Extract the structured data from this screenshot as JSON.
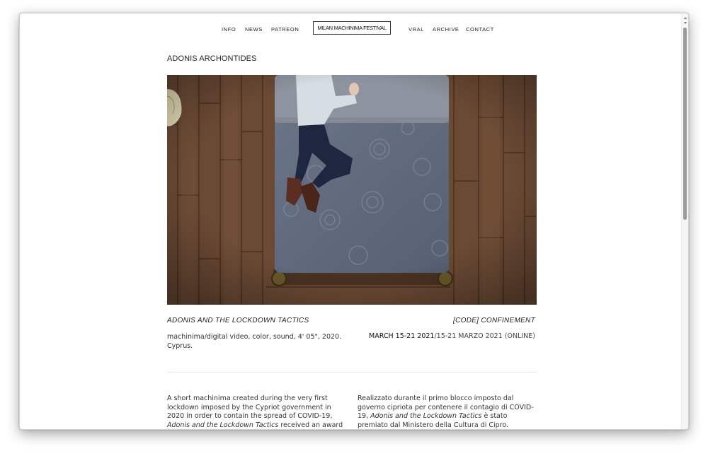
{
  "nav": {
    "left": [
      "INFO",
      "NEWS",
      "PATREON"
    ],
    "logo": "MILAN MACHINIMA FESTIVAL",
    "right": [
      "VRAL",
      "ARCHIVE",
      "CONTACT"
    ]
  },
  "artist": "ADONIS ARCHONTIDES",
  "film": {
    "title": "ADONIS AND THE LOCKDOWN TACTICS",
    "section": "[CODE] CONFINEMENT",
    "tech_info": "machinima/digital video, color, sound, 4' 05\", 2020. Cyprus.",
    "dates_primary": "MARCH 15-21 2021",
    "dates_secondary": "/15-21 MARZO 2021 (ONLINE)"
  },
  "description": {
    "en_before": "A short machinima created during the very first lockdown imposed by the Cypriot government in 2020 in order to contain the spread of COVID-19, ",
    "en_title": "Adonis and the Lockdown Tactics",
    "en_after": " received an award",
    "it_before": "Realizzato durante il primo blocco imposto dal governo cipriota per contenere il contagio di COVID-19, ",
    "it_title": "Adonis and the Lockdown Tactics",
    "it_after": " è stato premiato dal Ministero della Cultura di Cipro."
  },
  "colors": {
    "floor": "#6b4a34",
    "blanket": "#5f6a7e",
    "pillow": "#8e949f"
  }
}
